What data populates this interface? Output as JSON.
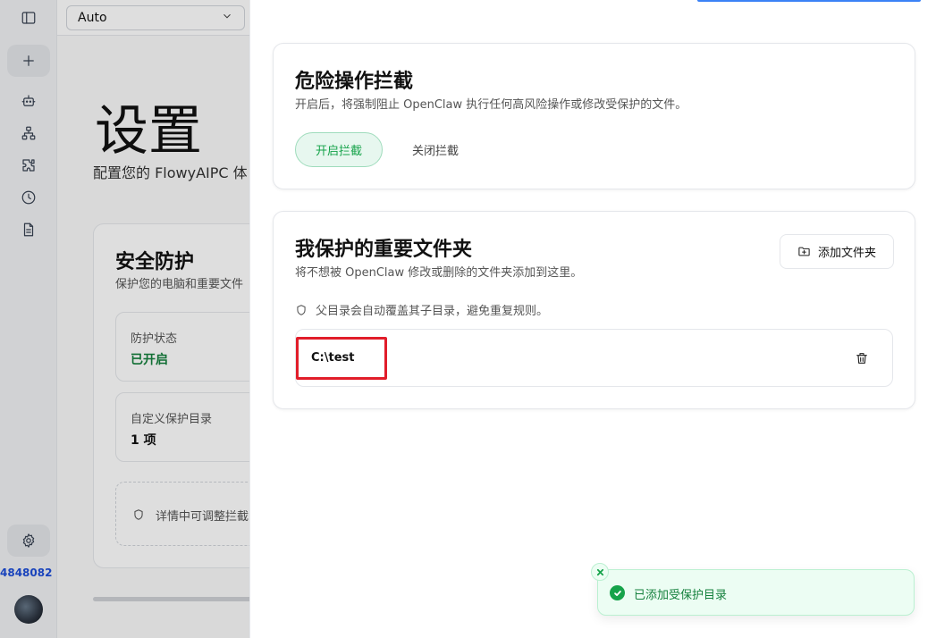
{
  "topbar": {
    "model_select_value": "Auto"
  },
  "sidebar": {
    "user_id_suffix": "4848082"
  },
  "settings_page": {
    "title": "设置",
    "subtitle": "配置您的 FlowyAIPC 体",
    "security_card": {
      "title": "安全防护",
      "subtitle": "保护您的电脑和重要文件",
      "protection_status_label": "防护状态",
      "protection_status_value": "已开启",
      "custom_dirs_label": "自定义保护目录",
      "custom_dirs_value": "1 项",
      "hint": "详情中可调整拦截"
    }
  },
  "drawer": {
    "danger_card": {
      "title": "危险操作拦截",
      "description": "开启后，将强制阻止 OpenClaw 执行任何高风险操作或修改受保护的文件。",
      "enable_label": "开启拦截",
      "disable_label": "关闭拦截"
    },
    "folders_card": {
      "title": "我保护的重要文件夹",
      "description": "将不想被 OpenClaw 修改或删除的文件夹添加到这里。",
      "add_button_label": "添加文件夹",
      "hint": "父目录会自动覆盖其子目录，避免重复规则。",
      "folders": [
        {
          "path": "C:\\test"
        }
      ]
    }
  },
  "toast": {
    "message": "已添加受保护目录"
  }
}
